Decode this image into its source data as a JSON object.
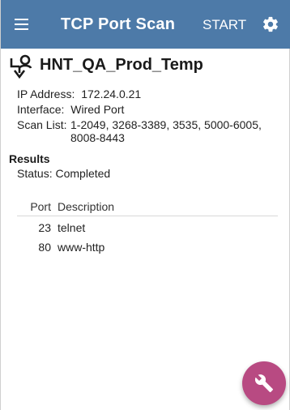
{
  "appbar": {
    "title": "TCP Port Scan",
    "start_label": "START",
    "menu_icon": "menu-icon",
    "settings_icon": "gear-icon",
    "color": "#4d7aa8"
  },
  "target": {
    "name": "HNT_QA_Prod_Temp",
    "icon": "scan-target-icon"
  },
  "details": {
    "ip_label": "IP Address:",
    "ip_value": "172.24.0.21",
    "interface_label": "Interface:",
    "interface_value": "Wired Port",
    "scanlist_label": "Scan List:",
    "scanlist_value": "1-2049, 3268-3389, 3535, 5000-6005, 8008-8443"
  },
  "results": {
    "title": "Results",
    "status_label": "Status:",
    "status_value": "Completed",
    "columns": {
      "port": "Port",
      "description": "Description"
    },
    "rows": [
      {
        "port": "23",
        "description": "telnet"
      },
      {
        "port": "80",
        "description": "www-http"
      }
    ]
  },
  "fab": {
    "icon": "wrench-icon",
    "color": "#b84a82"
  }
}
